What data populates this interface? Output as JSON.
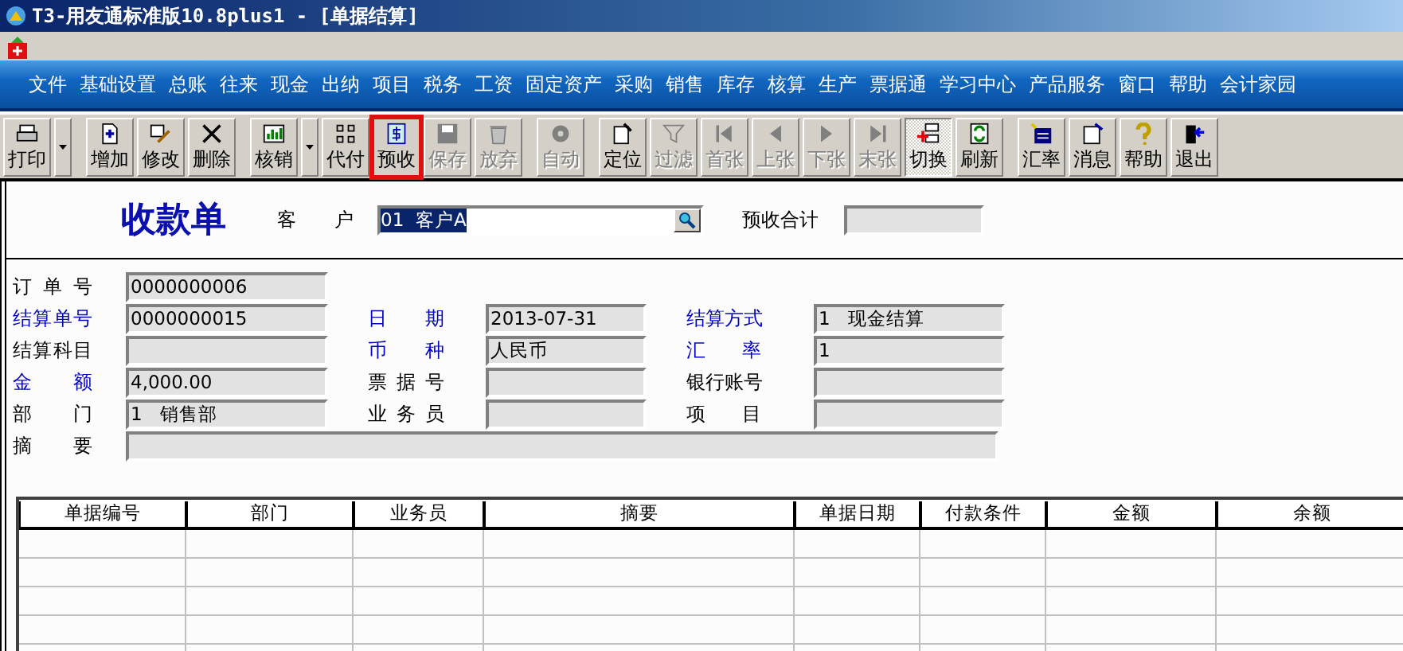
{
  "window": {
    "title": "T3-用友通标准版10.8plus1 - [单据结算]"
  },
  "menu": [
    "文件",
    "基础设置",
    "总账",
    "往来",
    "现金",
    "出纳",
    "项目",
    "税务",
    "工资",
    "固定资产",
    "采购",
    "销售",
    "库存",
    "核算",
    "生产",
    "票据通",
    "学习中心",
    "产品服务",
    "窗口",
    "帮助",
    "会计家园"
  ],
  "toolbar": {
    "groups": [
      {
        "buttons": [
          {
            "label": "打印",
            "disabled": false,
            "selected": false,
            "highlighted": false,
            "dropdown": true
          }
        ]
      },
      {
        "buttons": [
          {
            "label": "增加",
            "disabled": false,
            "selected": false,
            "highlighted": false,
            "dropdown": false
          },
          {
            "label": "修改",
            "disabled": false,
            "selected": false,
            "highlighted": false,
            "dropdown": false
          },
          {
            "label": "删除",
            "disabled": false,
            "selected": false,
            "highlighted": false,
            "dropdown": false
          }
        ]
      },
      {
        "buttons": [
          {
            "label": "核销",
            "disabled": false,
            "selected": false,
            "highlighted": false,
            "dropdown": true
          },
          {
            "label": "代付",
            "disabled": false,
            "selected": false,
            "highlighted": false,
            "dropdown": false
          },
          {
            "label": "预收",
            "disabled": false,
            "selected": false,
            "highlighted": true,
            "dropdown": false
          },
          {
            "label": "保存",
            "disabled": true,
            "selected": false,
            "highlighted": false,
            "dropdown": false
          },
          {
            "label": "放弃",
            "disabled": true,
            "selected": false,
            "highlighted": false,
            "dropdown": false
          }
        ]
      },
      {
        "buttons": [
          {
            "label": "自动",
            "disabled": true,
            "selected": false,
            "highlighted": false,
            "dropdown": false
          }
        ]
      },
      {
        "buttons": [
          {
            "label": "定位",
            "disabled": false,
            "selected": false,
            "highlighted": false,
            "dropdown": false
          },
          {
            "label": "过滤",
            "disabled": true,
            "selected": false,
            "highlighted": false,
            "dropdown": false
          },
          {
            "label": "首张",
            "disabled": true,
            "selected": false,
            "highlighted": false,
            "dropdown": false
          },
          {
            "label": "上张",
            "disabled": true,
            "selected": false,
            "highlighted": false,
            "dropdown": false
          },
          {
            "label": "下张",
            "disabled": true,
            "selected": false,
            "highlighted": false,
            "dropdown": false
          },
          {
            "label": "末张",
            "disabled": true,
            "selected": false,
            "highlighted": false,
            "dropdown": false
          },
          {
            "label": "切换",
            "disabled": false,
            "selected": true,
            "highlighted": false,
            "dropdown": false
          },
          {
            "label": "刷新",
            "disabled": false,
            "selected": false,
            "highlighted": false,
            "dropdown": false
          }
        ]
      },
      {
        "buttons": [
          {
            "label": "汇率",
            "disabled": false,
            "selected": false,
            "highlighted": false,
            "dropdown": false
          },
          {
            "label": "消息",
            "disabled": false,
            "selected": false,
            "highlighted": false,
            "dropdown": false
          },
          {
            "label": "帮助",
            "disabled": false,
            "selected": false,
            "highlighted": false,
            "dropdown": false
          },
          {
            "label": "退出",
            "disabled": false,
            "selected": false,
            "highlighted": false,
            "dropdown": false
          }
        ]
      }
    ]
  },
  "form": {
    "title": "收款单",
    "customer": {
      "label": "客 户",
      "value": "01  客户A",
      "text_selected": true
    },
    "advance_total": {
      "label": "预收合计"
    },
    "rows": [
      [
        {
          "label": "订 单 号",
          "required": false,
          "value": "0000000006"
        }
      ],
      [
        {
          "label": "结算单号",
          "required": true,
          "value": "0000000015"
        },
        {
          "label": "日 期",
          "required": true,
          "value": "2013-07-31"
        },
        {
          "label": "结算方式",
          "required": true,
          "value": "1   现金结算"
        }
      ],
      [
        {
          "label": "结算科目",
          "required": false
        },
        {
          "label": "币 种",
          "required": true,
          "value": "人民币"
        },
        {
          "label": "汇 率",
          "required": true,
          "value": "1"
        }
      ],
      [
        {
          "label": "金 额",
          "required": true,
          "value": "4,000.00"
        },
        {
          "label": "票 据 号",
          "required": false
        },
        {
          "label": "银行账号",
          "required": false
        }
      ],
      [
        {
          "label": "部 门",
          "required": false,
          "value": "1   销售部"
        },
        {
          "label": "业 务 员",
          "required": false
        },
        {
          "label": "项 目",
          "required": false
        }
      ]
    ],
    "memo": {
      "label": "摘 要",
      "required": false
    }
  },
  "table": {
    "columns": [
      "单据编号",
      "部门",
      "业务员",
      "摘要",
      "单据日期",
      "付款条件",
      "金额",
      "余额"
    ]
  }
}
